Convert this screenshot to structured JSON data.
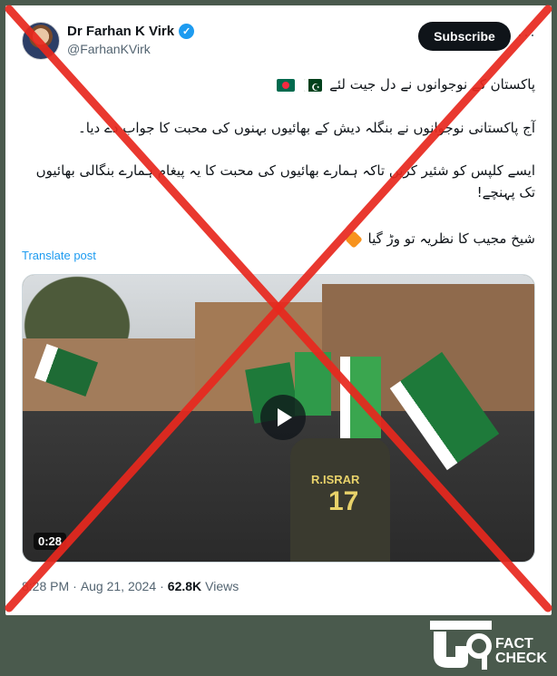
{
  "author": {
    "display_name": "Dr Farhan K Virk",
    "handle": "@FarhanKVirk",
    "verified_icon": "verified-badge-icon"
  },
  "actions": {
    "subscribe_label": "Subscribe",
    "more_label": "···"
  },
  "post": {
    "line1": "پاکستان کے نوجوانوں نے دل جیت لئے",
    "line2": "آج پاکستانی نوجوانوں نے بنگلہ دیش کے بھائیوں بہنوں کی محبت کا جواب دے دیا۔",
    "line3": "ایسے کلپس کو شئیر کریں تاکہ ہمارے بھائیوں کی محبت کا یہ پیغام ہمارے بنگالی بھائیوں تک پہنچے!",
    "line4": "شیخ مجیب کا نظریہ تو وڑ گیا",
    "translate_label": "Translate post"
  },
  "video": {
    "duration": "0:28",
    "jersey_name": "R.ISRAR",
    "jersey_number": "17"
  },
  "meta": {
    "time": "8:28 PM",
    "separator": "·",
    "date": "Aug 21, 2024",
    "views_count": "62.8K",
    "views_label": "Views"
  },
  "logo": {
    "fact": "FACT",
    "check": "CHECK"
  },
  "colors": {
    "accent": "#1d9bf0",
    "cross": "#e8281e",
    "background": "#4a5a4d"
  }
}
